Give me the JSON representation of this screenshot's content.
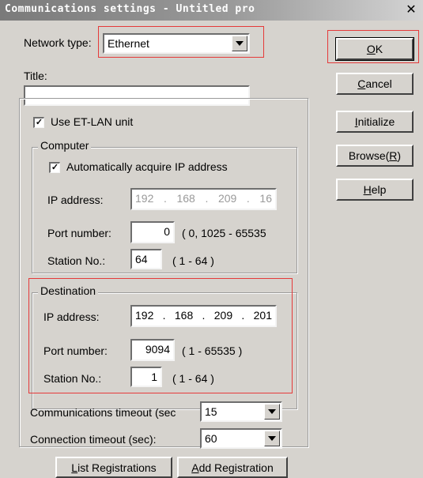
{
  "window": {
    "title": "Communications settings - Untitled pro",
    "close_glyph": "✕"
  },
  "network": {
    "label": "Network type:",
    "value": "Ethernet"
  },
  "title_field": {
    "label": "Title:",
    "value": ""
  },
  "use_etlan": {
    "label": "Use ET-LAN unit",
    "checked": true
  },
  "computer": {
    "legend": "Computer",
    "auto_ip": {
      "label": "Automatically acquire IP address",
      "checked": true
    },
    "ip_label": "IP address:",
    "ip": [
      "192",
      "168",
      "209",
      "16"
    ],
    "port_label": "Port number:",
    "port": "0",
    "port_range": "( 0, 1025 - 65535",
    "station_label": "Station No.:",
    "station": "64",
    "station_range": "( 1 - 64 )"
  },
  "destination": {
    "legend": "Destination",
    "ip_label": "IP address:",
    "ip": [
      "192",
      "168",
      "209",
      "201"
    ],
    "port_label": "Port number:",
    "port": "9094",
    "port_range": "( 1 - 65535 )",
    "station_label": "Station No.:",
    "station": "1",
    "station_range": "( 1 - 64 )"
  },
  "timeout": {
    "label": "Communications timeout (sec",
    "value": "15"
  },
  "conn_timeout": {
    "label": "Connection timeout (sec):",
    "value": "60"
  },
  "buttons": {
    "ok": {
      "mnemonic": "O",
      "rest": "K"
    },
    "cancel": {
      "mnemonic": "C",
      "rest": "ancel"
    },
    "initialize": {
      "mnemonic": "I",
      "rest": "nitialize"
    },
    "browse": {
      "pre": "Browse(",
      "mnemonic": "R",
      "post": ")"
    },
    "help": {
      "mnemonic": "H",
      "rest": "elp"
    },
    "list_registrations": {
      "mnemonic": "L",
      "rest": "ist Registrations"
    },
    "add_registration": {
      "mnemonic": "A",
      "rest": "dd Registration"
    }
  },
  "colors": {
    "highlight_box": "#e53a3a"
  }
}
